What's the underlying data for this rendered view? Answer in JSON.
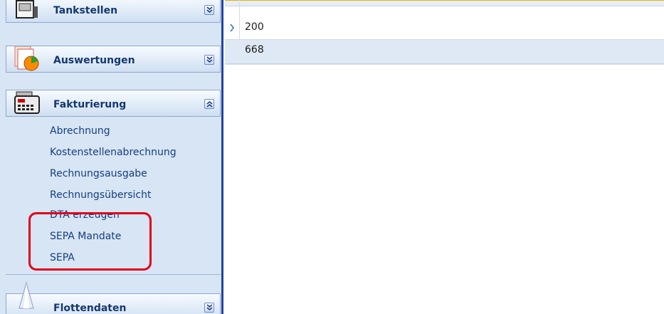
{
  "sidebar": {
    "groups": [
      {
        "label": "Tankstellen",
        "icon": "fuel-station-icon"
      },
      {
        "label": "Auswertungen",
        "icon": "report-chart-icon"
      },
      {
        "label": "Fakturierung",
        "icon": "cash-register-icon"
      },
      {
        "label": "Flottendaten",
        "icon": "fleet-icon"
      }
    ],
    "fakturierung_items": [
      "Abrechnung",
      "Kostenstellenabrechnung",
      "Rechnungsausgabe",
      "Rechnungsübersicht",
      "DTA erzeugen",
      "SEPA Mandate",
      "SEPA"
    ]
  },
  "grid": {
    "rows": [
      {
        "value": "200",
        "selected": true
      },
      {
        "value": "668",
        "selected": false
      }
    ]
  },
  "colors": {
    "highlight": "#e0001a",
    "sidebar_border": "#23429e",
    "link": "#123f82"
  }
}
